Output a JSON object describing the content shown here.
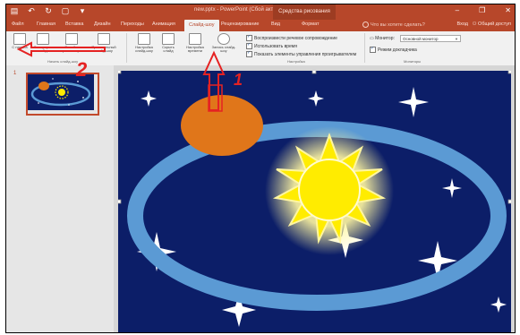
{
  "titlebar": {
    "title": "new.pptx - PowerPoint (Сбой активации продукта)",
    "context_label": "Средства рисования",
    "window_controls": [
      "minimize-icon",
      "restore-icon",
      "close-icon"
    ]
  },
  "tabs": {
    "file": "Файл",
    "home": "Главная",
    "insert": "Вставка",
    "design": "Дизайн",
    "transitions": "Переходы",
    "animation": "Анимация",
    "slideshow": "Слайд-шоу",
    "review": "Рецензирование",
    "view": "Вид",
    "format": "Формат",
    "tell_me": "Что вы хотите сделать?",
    "signin": "Вход",
    "share": "Общий доступ"
  },
  "ribbon": {
    "start": {
      "from_beginning": "С начала",
      "from_current": "С текущего слайда",
      "online": "Онлайн-презентация",
      "custom": "Произвольный слайд-шоу",
      "group_label": "Начать слайд-шоу"
    },
    "setup": {
      "setup_btn": "Настройка слайд-шоу",
      "hide_btn": "Скрыть слайд",
      "rehearse_btn": "Настройка времени",
      "record_btn": "Запись слайд-шоу",
      "group_label": "Настройка",
      "checkboxes": [
        {
          "label": "Воспроизвести речевое сопровождение",
          "checked": true
        },
        {
          "label": "Использовать время",
          "checked": true
        },
        {
          "label": "Показать элементы управления проигрывателем",
          "checked": true
        }
      ]
    },
    "monitors": {
      "monitor_label": "Монитор:",
      "monitor_value": "Основной монитор",
      "presenter_label": "Режим докладчика",
      "presenter_checked": true,
      "group_label": "Мониторы"
    }
  },
  "thumbnails": [
    {
      "number": "1"
    }
  ],
  "annotations": {
    "label_1": "1",
    "label_2": "2"
  },
  "colors": {
    "accent": "#b7472a",
    "sky": "#0c1e68",
    "orbit": "#5b9ad4",
    "planet": "#e0761a",
    "sun": "#ffec00",
    "annotation": "#e52222"
  }
}
